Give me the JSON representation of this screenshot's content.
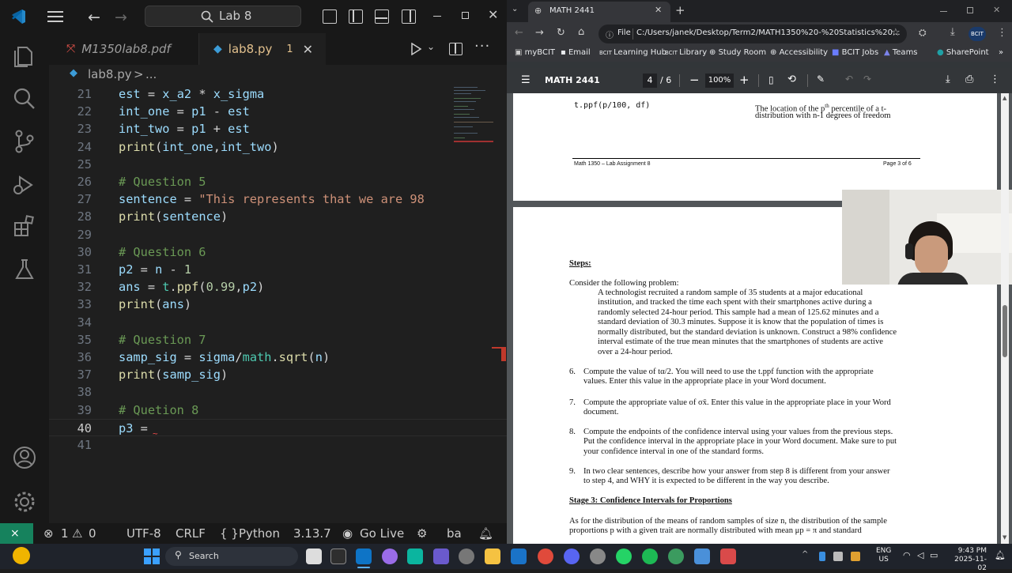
{
  "vscode": {
    "search_text": "Lab 8",
    "tabs": [
      {
        "label": "M1350lab8.pdf"
      },
      {
        "label": "lab8.py",
        "badge": "1"
      }
    ],
    "breadcrumb": {
      "file": "lab8.py",
      "sep": ">",
      "rest": "..."
    },
    "code_lines": [
      {
        "n": "21",
        "text": "est = x_a2 * x_sigma"
      },
      {
        "n": "22",
        "text": "int_one = p1 - est"
      },
      {
        "n": "23",
        "text": "int_two = p1 + est"
      },
      {
        "n": "24",
        "text": "print(int_one,int_two)"
      },
      {
        "n": "25",
        "text": ""
      },
      {
        "n": "26",
        "text": "# Question 5"
      },
      {
        "n": "27",
        "text": "sentence = \"This represents that we are 98"
      },
      {
        "n": "28",
        "text": "print(sentence)"
      },
      {
        "n": "29",
        "text": ""
      },
      {
        "n": "30",
        "text": "# Question 6"
      },
      {
        "n": "31",
        "text": "p2 = n - 1"
      },
      {
        "n": "32",
        "text": "ans = t.ppf(0.99,p2)"
      },
      {
        "n": "33",
        "text": "print(ans)"
      },
      {
        "n": "34",
        "text": ""
      },
      {
        "n": "35",
        "text": "# Question 7"
      },
      {
        "n": "36",
        "text": "samp_sig = sigma/math.sqrt(n)"
      },
      {
        "n": "37",
        "text": "print(samp_sig)"
      },
      {
        "n": "38",
        "text": ""
      },
      {
        "n": "39",
        "text": "# Quetion 8"
      },
      {
        "n": "40",
        "text": "p3 ="
      },
      {
        "n": "41",
        "text": ""
      }
    ],
    "status": {
      "errors": "1",
      "warnings": "0",
      "encoding": "UTF-8",
      "eol": "CRLF",
      "lang_braces": "{ }",
      "language": "Python",
      "version": "3.13.7",
      "golive": "Go Live",
      "ba": "ba"
    }
  },
  "browser": {
    "tab_title": "MATH 2441",
    "address_prefix": "File",
    "address": "C:/Users/janek/Desktop/Term2/MATH1350%20-%20Statistics%20...",
    "bookmarks": [
      "myBCIT",
      "Email",
      "Learning Hub",
      "Library",
      "Study Room",
      "Accessibility",
      "BCIT Jobs",
      "Teams",
      "SharePoint"
    ],
    "pdf": {
      "title": "MATH 2441",
      "page_current": "4",
      "page_total": "/ 6",
      "zoom": "100%",
      "page3": {
        "cmd": "t.ppf(p/100, df)",
        "desc_line1": "The location of the p",
        "desc_sup": "th",
        "desc_line1b": " percentile of a t-",
        "desc_line2": "distribution with n-1 degrees of freedom",
        "footer_left": "Math 1350 – Lab Assignment 8",
        "footer_right": "Page 3 of 6"
      },
      "page4": {
        "steps_heading": "Steps:",
        "intro": "Consider the following problem:",
        "problem_lines": [
          "A technologist recruited a random sample of 35 students at a major educational",
          "institution, and tracked the time each spent with their smartphones active during a",
          "randomly selected 24-hour period.  This sample had a mean of 125.62 minutes and a",
          "standard deviation of 30.3 minutes. Suppose it is know that the population of times is",
          "normally distributed, but the standard deviation is unknown. Construct a 98% confidence",
          "interval estimate of the true mean minutes that the smartphones of students are active",
          "over a 24-hour period."
        ],
        "items": [
          {
            "num": "6.",
            "lines": [
              "Compute the value of tα/2. You will need to use the t.ppf function with the appropriate",
              "values. Enter this value in the appropriate place in your Word document."
            ]
          },
          {
            "num": "7.",
            "lines": [
              "Compute the appropriate value of σx̄. Enter this value in the appropriate place in your Word",
              "document."
            ]
          },
          {
            "num": "8.",
            "lines": [
              "Compute the endpoints of the confidence interval using your values from the previous steps.",
              "Put the confidence interval in the appropriate place in your Word document. Make sure to put",
              "your confidence interval in one of the standard forms."
            ]
          },
          {
            "num": "9.",
            "lines": [
              "In two clear sentences, describe how your answer from step 8 is different from your answer",
              "to step 4, and WHY it is expected to be different in the way you describe."
            ]
          }
        ],
        "stage_heading": "Stage 3: Confidence Intervals for Proportions",
        "stage_lines": [
          "As for the distribution of the means of random samples of size n, the distribution of the sample",
          "proportions p with a given trait are normally distributed with mean μp = π and standard"
        ]
      }
    }
  },
  "taskbar": {
    "search_label": "Search",
    "lang_top": "ENG",
    "lang_bottom": "US",
    "time": "9:43 PM",
    "date": "2025-11-02"
  }
}
